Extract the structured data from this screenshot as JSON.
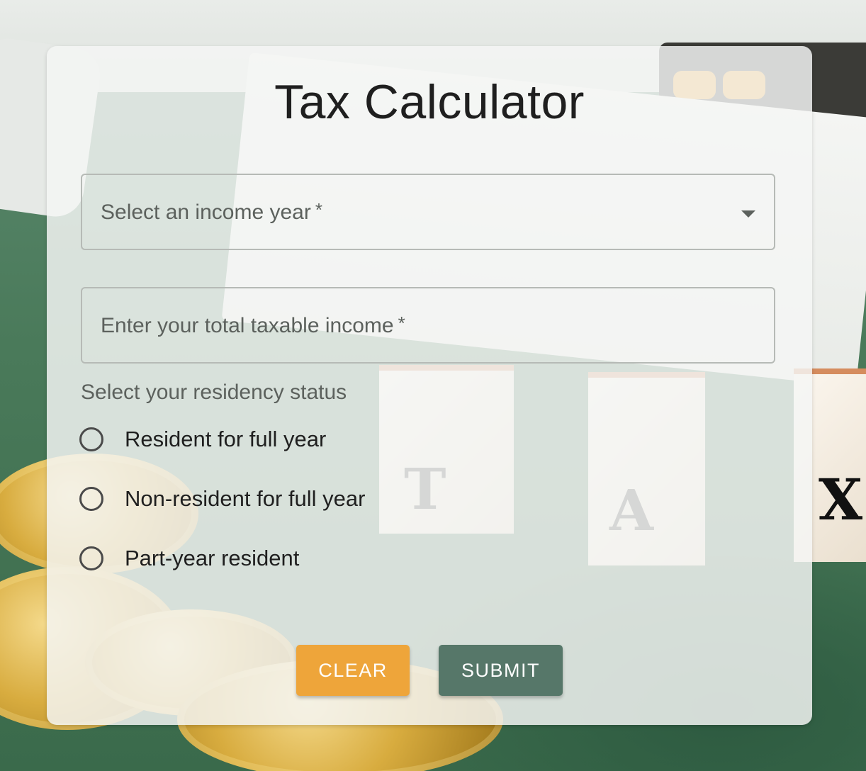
{
  "page": {
    "title": "Tax Calculator"
  },
  "form": {
    "income_year": {
      "placeholder": "Select an income year",
      "required_mark": "*"
    },
    "taxable_income": {
      "placeholder": "Enter your total taxable income",
      "required_mark": "*"
    },
    "residency": {
      "label": "Select your residency status",
      "options": [
        {
          "label": "Resident for full year",
          "selected": false
        },
        {
          "label": "Non-resident for full year",
          "selected": false
        },
        {
          "label": "Part-year resident",
          "selected": false
        }
      ]
    },
    "buttons": {
      "clear_label": "CLEAR",
      "submit_label": "SUBMIT"
    }
  },
  "background": {
    "blocks": [
      "T",
      "A",
      "X"
    ]
  },
  "colors": {
    "clear_button": "#eea53a",
    "submit_button": "#567769",
    "card": "#f4f6f4"
  }
}
